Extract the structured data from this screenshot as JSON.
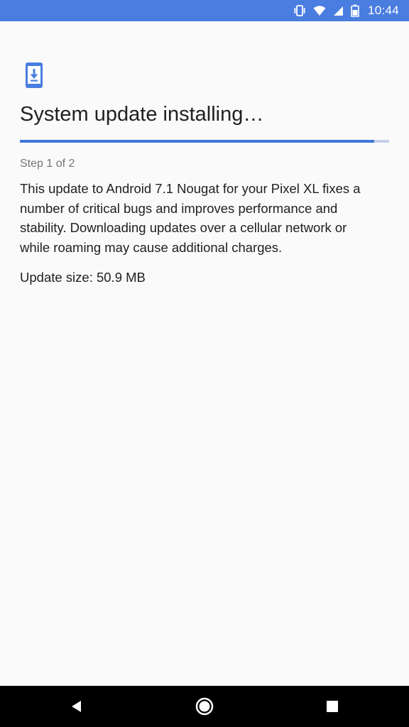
{
  "status_bar": {
    "time": "10:44",
    "background_color": "#4a7de0",
    "icons": [
      "vibrate-icon",
      "wifi-icon",
      "cell-signal-icon",
      "battery-icon"
    ]
  },
  "main": {
    "icon": "system-update-icon",
    "title": "System update installing…",
    "progress": 0.96,
    "accent_color": "#3f76d9",
    "step": "Step 1 of 2",
    "description": "This update to Android 7.1 Nougat for your Pixel XL fixes a number of critical bugs and improves performance and stability. Downloading updates over a cellular network or while roaming may cause additional charges.",
    "update_size": "Update size: 50.9 MB"
  },
  "nav_bar": {
    "buttons": [
      "back",
      "home",
      "recents"
    ]
  }
}
